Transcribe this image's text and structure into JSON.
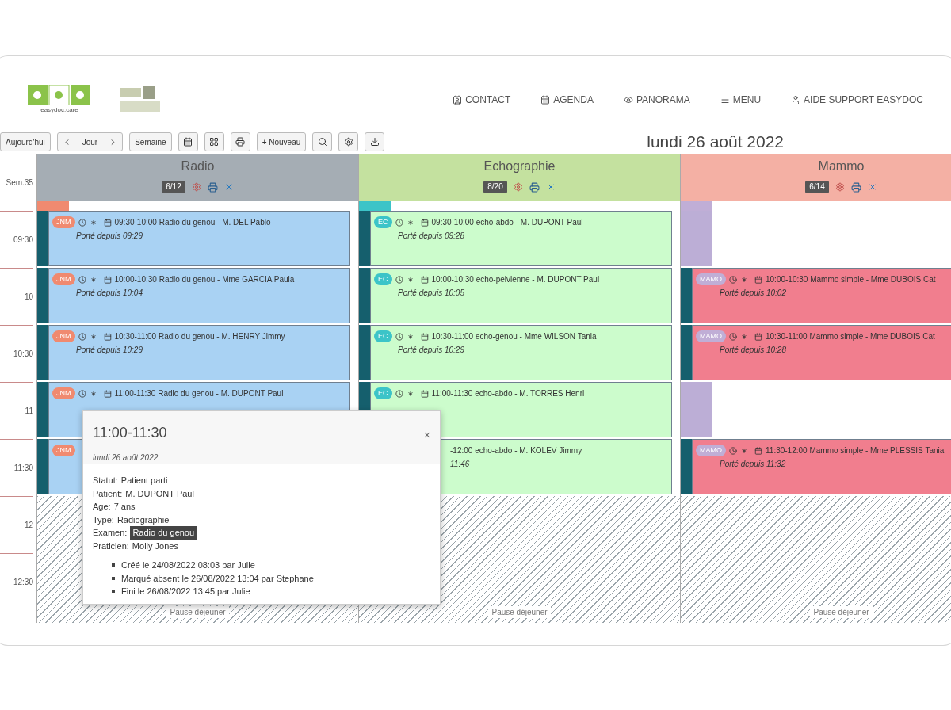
{
  "logo": {
    "caption": "easydoc.care"
  },
  "nav": [
    {
      "label": "CONTACT"
    },
    {
      "label": "AGENDA"
    },
    {
      "label": "PANORAMA"
    },
    {
      "label": "MENU"
    },
    {
      "label": "AIDE SUPPORT EASYDOC"
    }
  ],
  "toolbar": [
    {
      "kind": "text",
      "label": "Aujourd'hui"
    },
    {
      "kind": "pager",
      "label": "Jour"
    },
    {
      "kind": "text",
      "label": "Semaine"
    },
    {
      "kind": "icon"
    },
    {
      "kind": "icon"
    },
    {
      "kind": "icon"
    },
    {
      "kind": "text",
      "label": "+ Nouveau"
    },
    {
      "kind": "icon"
    },
    {
      "kind": "icon"
    },
    {
      "kind": "icon"
    }
  ],
  "date": "lundi 26 août 2022",
  "week": "Sem.35",
  "times": [
    "09:30",
    "10",
    "10:30",
    "11",
    "11:30",
    "12",
    "12:30"
  ],
  "columns": [
    {
      "name": "Radio",
      "count": "6/12",
      "color": "#a5adb4",
      "slots": [
        {
          "kind": "event",
          "badge": "JNM",
          "title": "09:30-10:00 Radio du genou - M. DEL Pablo",
          "note": "Porté depuis 09:29"
        },
        {
          "kind": "event",
          "badge": "JNM",
          "title": "10:00-10:30 Radio du genou - Mme GARCIA Paula",
          "note": "Porté depuis 10:04"
        },
        {
          "kind": "event",
          "badge": "JNM",
          "title": "10:30-11:00 Radio du genou - M. HENRY Jimmy",
          "note": "Porté depuis 10:29"
        },
        {
          "kind": "event",
          "badge": "JNM",
          "title": "11:00-11:30 Radio du genou - M. DUPONT Paul"
        },
        {
          "kind": "event",
          "badge": "JNM"
        },
        {
          "kind": "closed",
          "label": "Pause déjeuner"
        }
      ]
    },
    {
      "name": "Echographie",
      "count": "8/20",
      "color": "#c4e19f",
      "slots": [
        {
          "kind": "event",
          "badge": "EC",
          "title": "09:30-10:00 echo-abdo - M. DUPONT Paul",
          "note": "Porté depuis 09:28"
        },
        {
          "kind": "event",
          "badge": "EC",
          "title": "10:00-10:30 echo-pelvienne - M. DUPONT Paul",
          "note": "Porté depuis 10:05"
        },
        {
          "kind": "event",
          "badge": "EC",
          "title": "10:30-11:00 echo-genou - Mme WILSON Tania",
          "note": "Porté depuis 10:29"
        },
        {
          "kind": "event",
          "badge": "EC",
          "title": "11:00-11:30 echo-abdo - M. TORRES Henri"
        },
        {
          "kind": "event",
          "title": "-12:00 echo-abdo - M. KOLEV Jimmy",
          "note": "11:46"
        },
        {
          "kind": "closed",
          "label": "Pause déjeuner"
        }
      ]
    },
    {
      "name": "Mammo",
      "count": "6/14",
      "color": "#f4b0a4",
      "slots": [
        {
          "kind": "blocked"
        },
        {
          "kind": "event",
          "badge": "MAMO",
          "title": "10:00-10:30 Mammo simple - Mme DUBOIS Cat",
          "note": "Porté depuis 10:02"
        },
        {
          "kind": "event",
          "badge": "MAMO",
          "title": "10:30-11:00 Mammo simple - Mme DUBOIS Cat",
          "note": "Porté depuis 10:28"
        },
        {
          "kind": "blocked"
        },
        {
          "kind": "event",
          "badge": "MAMO",
          "title": "11:30-12:00 Mammo simple - Mme PLESSIS Tania",
          "note": "Porté depuis 11:32"
        },
        {
          "kind": "closed",
          "label": "Pause déjeuner"
        }
      ]
    }
  ],
  "popup": {
    "time": "11:00-11:30",
    "date": "lundi 26 août 2022",
    "fields": [
      {
        "label": "Statut:",
        "value": "Patient parti"
      },
      {
        "label": "Patient:",
        "value": "M. DUPONT Paul"
      },
      {
        "label": "Age:",
        "value": "7 ans"
      },
      {
        "label": "Type:",
        "value": "Radiographie"
      },
      {
        "label": "Examen:",
        "value": "Radio du genou",
        "highlight": true
      },
      {
        "label": "Praticien:",
        "value": "Molly Jones"
      }
    ],
    "history": [
      "Créé le 24/08/2022 08:03 par Julie",
      "Marqué absent le 26/08/2022 13:04 par Stephane",
      "Fini le 26/08/2022 13:45 par Julie"
    ],
    "close": "×"
  }
}
